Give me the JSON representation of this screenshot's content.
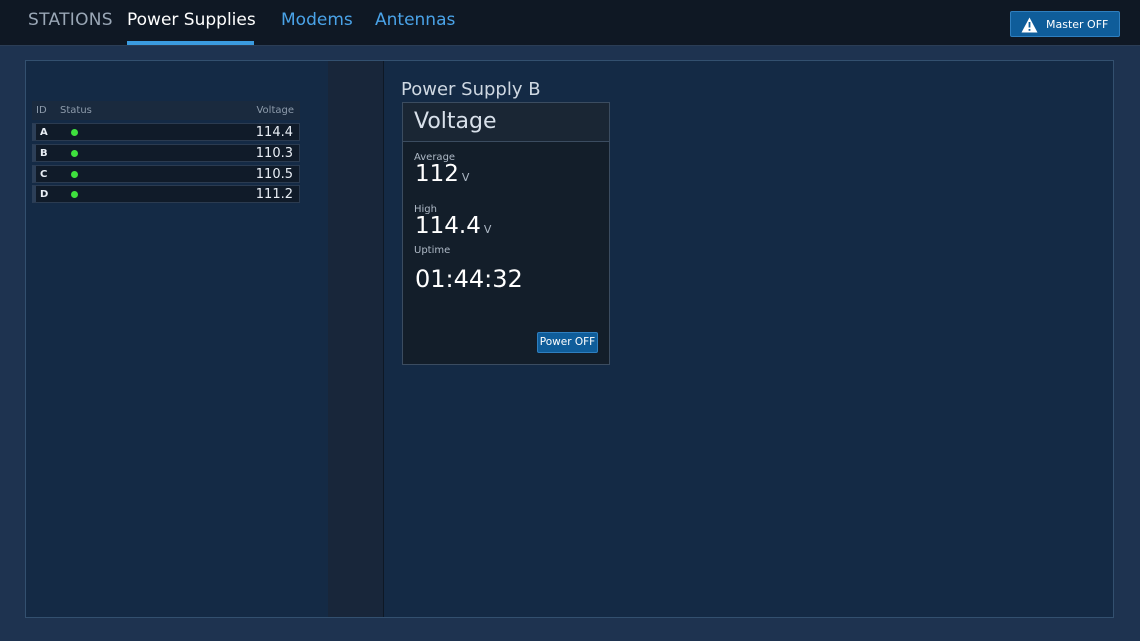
{
  "nav": {
    "brand": "STATIONS",
    "tabs": [
      {
        "label": "Power Supplies",
        "active": true
      },
      {
        "label": "Modems",
        "active": false
      },
      {
        "label": "Antennas",
        "active": false
      }
    ],
    "master_button": {
      "label": "Master OFF",
      "icon": "warning-icon"
    }
  },
  "table": {
    "headers": {
      "id": "ID",
      "status": "Status",
      "voltage": "Voltage"
    },
    "rows": [
      {
        "id": "A",
        "status": "ok",
        "voltage": "114.4"
      },
      {
        "id": "B",
        "status": "ok",
        "voltage": "110.3"
      },
      {
        "id": "C",
        "status": "ok",
        "voltage": "110.5"
      },
      {
        "id": "D",
        "status": "ok",
        "voltage": "111.2"
      }
    ]
  },
  "detail": {
    "title": "Power Supply B",
    "card_title": "Voltage",
    "average_label": "Average",
    "average_value": "112",
    "average_unit": "V",
    "high_label": "High",
    "high_value": "114.4",
    "high_unit": "V",
    "uptime_label": "Uptime",
    "uptime_value": "01:44:32",
    "power_button": "Power OFF"
  },
  "colors": {
    "accent": "#3a9be0",
    "status_ok": "#3ee03e",
    "button": "#0f5d9a"
  }
}
